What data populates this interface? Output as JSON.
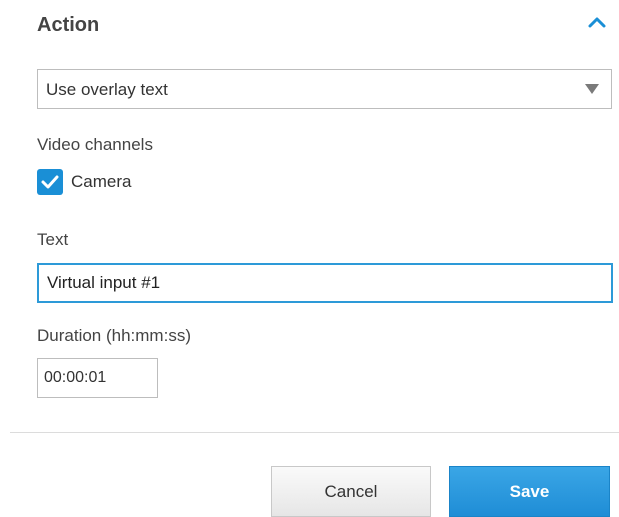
{
  "section": {
    "title": "Action",
    "toggle_icon": "chevron-up-icon"
  },
  "action_select": {
    "value": "Use overlay text",
    "arrow_icon": "triangle-down-icon"
  },
  "video_channels": {
    "label": "Video channels",
    "camera_label": "Camera",
    "camera_checked": true,
    "checkbox_color": "#1a8fd6"
  },
  "text_field": {
    "label": "Text",
    "value": "Virtual input #1",
    "focus_color": "#2d9ad8"
  },
  "duration_field": {
    "label": "Duration (hh:mm:ss)",
    "value": "00:00:01"
  },
  "footer": {
    "cancel_label": "Cancel",
    "save_label": "Save",
    "save_color": "#1f8dd6"
  }
}
